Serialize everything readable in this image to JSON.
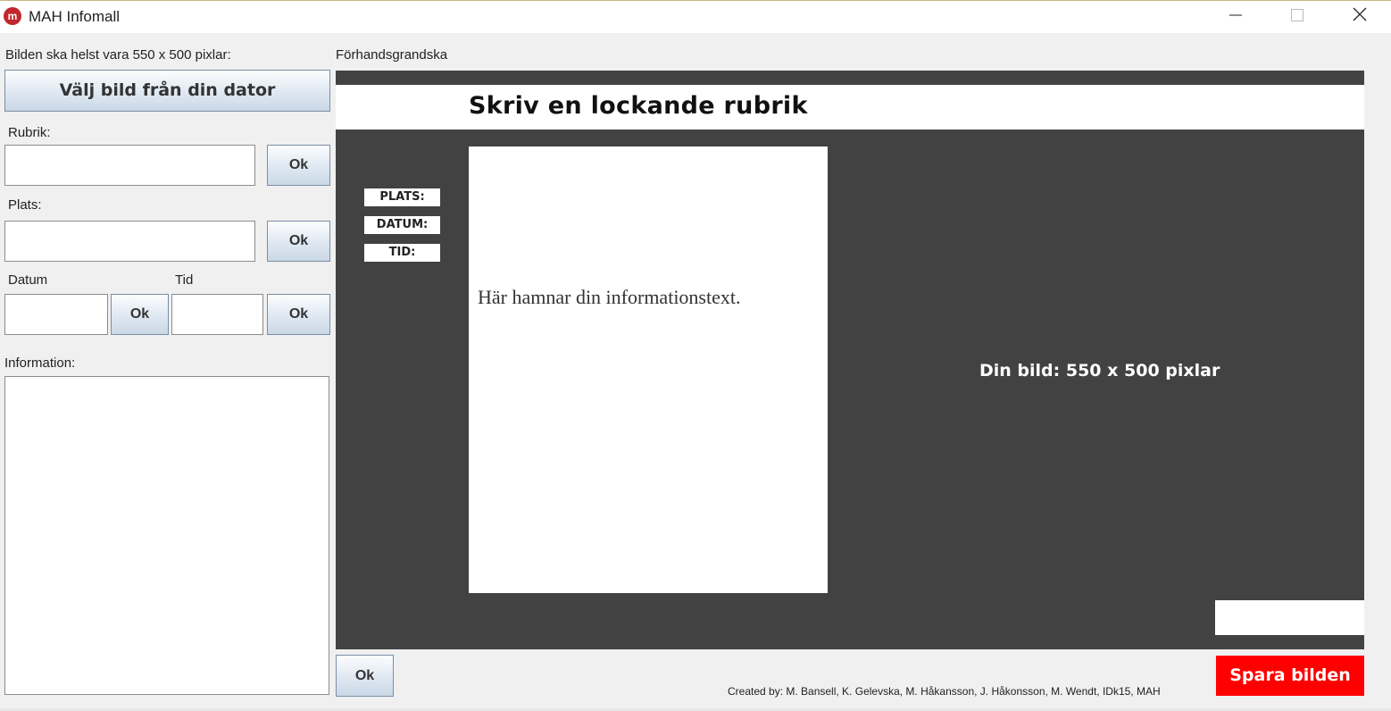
{
  "window": {
    "title": "MAH Infomall",
    "minimize": "—",
    "close": "✕"
  },
  "left": {
    "hint": "Bilden ska helst vara 550 x 500 pixlar:",
    "choose_button": "Välj bild från din dator",
    "rubrik_label": "Rubrik:",
    "plats_label": "Plats:",
    "datum_label": "Datum",
    "tid_label": "Tid",
    "ok_label": "Ok",
    "information_label": "Information:",
    "rubrik_value": "",
    "plats_value": "",
    "datum_value": "",
    "tid_value": "",
    "information_value": ""
  },
  "preview": {
    "label": "Förhandsgrandska",
    "headline": "Skriv en lockande rubrik",
    "tags": {
      "plats": "PLATS:",
      "datum": "DATUM:",
      "tid": "TID:"
    },
    "info_text": "Här hamnar din informationstext.",
    "image_placeholder": "Din bild: 550 x 500 pixlar"
  },
  "bottom": {
    "ok_label": "Ok",
    "save_button": "Spara bilden",
    "credits": "Created by:  M. Bansell, K. Gelevska, M. Håkansson, J. Håkonsson, M. Wendt, IDk15, MAH"
  },
  "colors": {
    "preview_bg": "#424242",
    "save_red": "#ff0000",
    "app_icon": "#c1272d"
  }
}
